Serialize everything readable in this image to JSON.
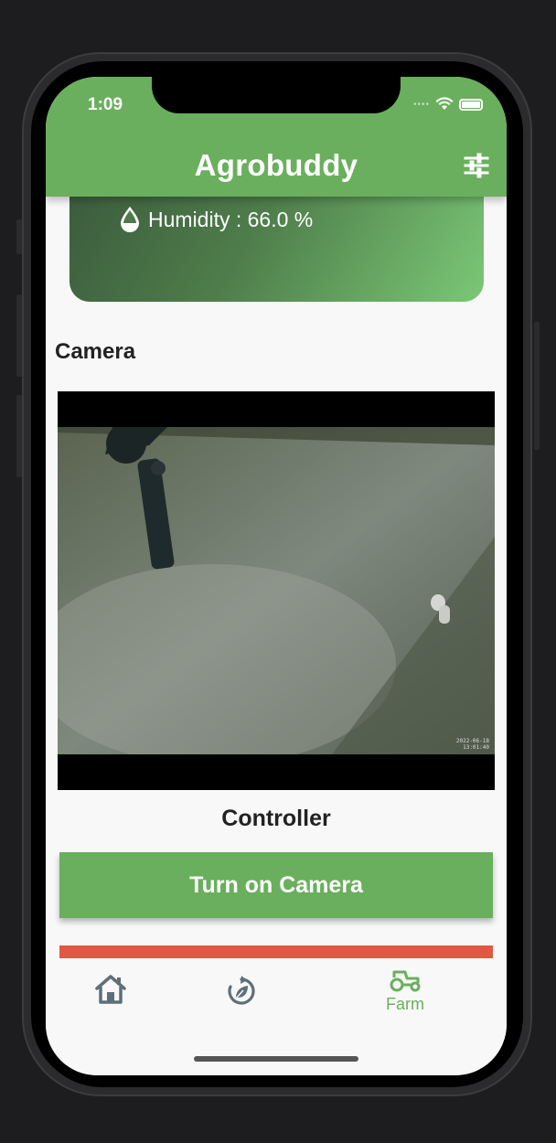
{
  "status_bar": {
    "time": "1:09"
  },
  "app_bar": {
    "title": "Agrobuddy"
  },
  "humidity": {
    "text": "Humidity : 66.0 %"
  },
  "camera_section": {
    "title": "Camera",
    "timestamp_line1": "2022-06-18",
    "timestamp_line2": "13:01:40"
  },
  "controller": {
    "title": "Controller",
    "turn_on_camera_label": "Turn on Camera"
  },
  "bottom_nav": {
    "items": [
      {
        "icon": "home-icon",
        "label": ""
      },
      {
        "icon": "recycle-leaf-icon",
        "label": ""
      },
      {
        "icon": "tractor-icon",
        "label": "Farm"
      }
    ]
  },
  "colors": {
    "primary_green": "#6aaf5d",
    "danger_red": "#e35745",
    "nav_icon_gray": "#5e6f7a"
  }
}
